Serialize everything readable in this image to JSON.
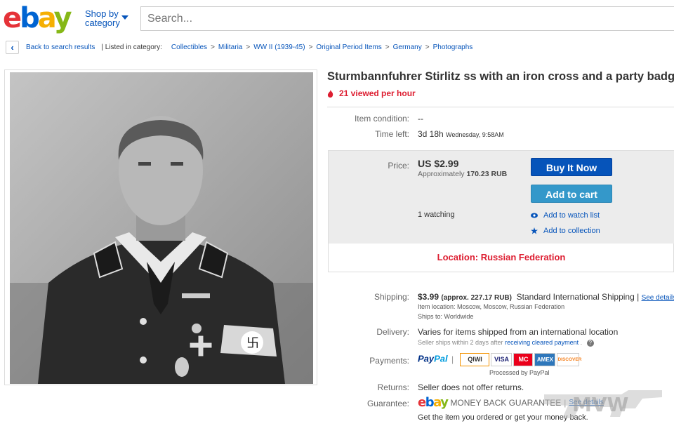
{
  "header": {
    "logo": [
      "e",
      "b",
      "a",
      "y"
    ],
    "shop_by": "Shop by",
    "category": "category",
    "search_placeholder": "Search..."
  },
  "breadcrumb": {
    "back": "Back to search results",
    "listed": "| Listed in category:",
    "items": [
      "Collectibles",
      "Militaria",
      "WW II (1939-45)",
      "Original Period Items",
      "Germany",
      "Photographs"
    ]
  },
  "item": {
    "title": "Sturmbannfuhrer Stirlitz ss with an iron cross and a party badge",
    "viewed": "21 viewed per hour",
    "condition_label": "Item condition:",
    "condition_value": "--",
    "time_label": "Time left:",
    "time_value": "3d 18h",
    "time_detail": "Wednesday, 9:58AM"
  },
  "price": {
    "label": "Price:",
    "value": "US $2.99",
    "approx_prefix": "Approximately",
    "approx_value": "170.23 RUB",
    "buy_now": "Buy It Now",
    "add_to_cart": "Add to cart",
    "watching": "1 watching",
    "watch_list": "Add to watch list",
    "collection": "Add to collection",
    "location": "Location: Russian Federation"
  },
  "shipping": {
    "label": "Shipping:",
    "cost": "$3.99",
    "approx": "(approx. 227.17 RUB)",
    "service": "Standard International Shipping |",
    "see_details": "See details",
    "item_location": "Item location:  Moscow, Moscow, Russian Federation",
    "ships_to": "Ships to:  Worldwide"
  },
  "delivery": {
    "label": "Delivery:",
    "value": "Varies for items shipped from an international location",
    "note_prefix": "Seller ships within 2 days after",
    "note_link": "receiving cleared payment",
    "note_suffix": "."
  },
  "payments": {
    "label": "Payments:",
    "paypal_1": "Pay",
    "paypal_2": "Pal",
    "cards": [
      "QIWI",
      "VISA",
      "MC",
      "AMEX",
      "DISCOVER"
    ],
    "processed": "Processed by PayPal"
  },
  "returns": {
    "label": "Returns:",
    "value": "Seller does not offer returns."
  },
  "guarantee": {
    "label": "Guarantee:",
    "brand": [
      "e",
      "b",
      "a",
      "y"
    ],
    "text": "MONEY BACK GUARANTEE",
    "see_details": "See details",
    "note": "Get the item you ordered or get your money back."
  },
  "watermark": "MVW",
  "colors": {
    "accent": "#0654ba",
    "alert": "#dd1e31",
    "cart": "#3498ca"
  }
}
